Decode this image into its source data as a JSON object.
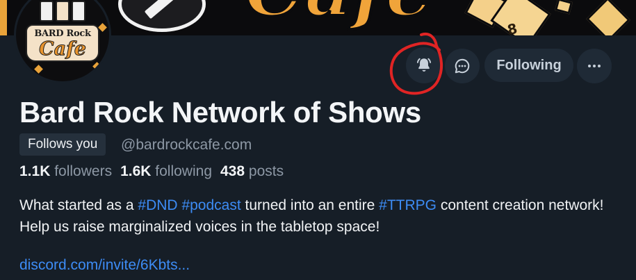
{
  "banner": {
    "script_text": "Cafe",
    "die_number": "8",
    "accent_color": "#f0a43a"
  },
  "avatar": {
    "line1": "BARD Rock",
    "line2": "Cafe"
  },
  "actions": {
    "notify_icon": "bell-icon",
    "message_icon": "chat-bubble-icon",
    "following_label": "Following",
    "more_icon": "ellipsis-icon",
    "annotation_color": "#e02424"
  },
  "profile": {
    "display_name": "Bard Rock Network of Shows",
    "follows_you": "Follows you",
    "handle": "@bardrockcafe.com",
    "stats": {
      "followers_count": "1.1K",
      "followers_label": "followers",
      "following_count": "1.6K",
      "following_label": "following",
      "posts_count": "438",
      "posts_label": "posts"
    },
    "bio": {
      "part1": "What started as a ",
      "tag1": "#DND",
      "sp1": " ",
      "tag2": "#podcast",
      "part2": " turned into an entire ",
      "tag3": "#TTRPG",
      "part3": " content creation network! Help us raise marginalized voices in the tabletop space!"
    },
    "link": "discord.com/invite/6Kbts...",
    "link_color": "#3d8cf5"
  }
}
